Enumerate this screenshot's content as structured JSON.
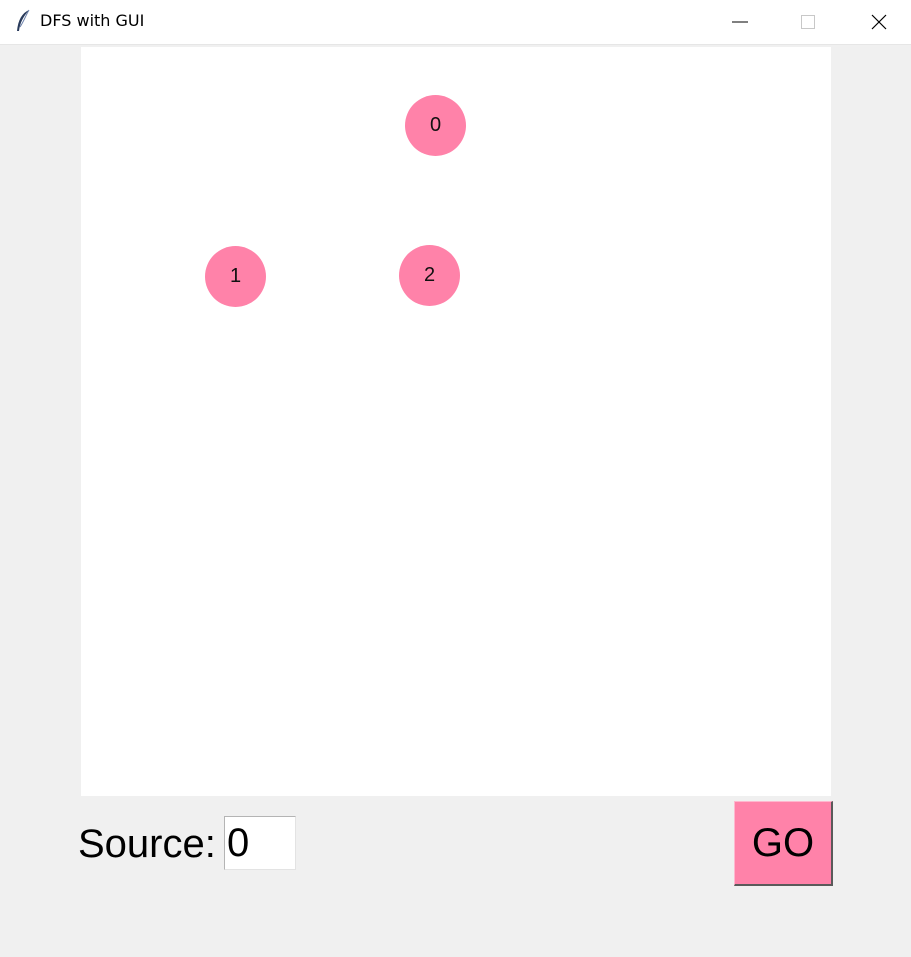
{
  "window": {
    "title": "DFS with GUI",
    "icon": "feather-icon"
  },
  "graph": {
    "nodes": [
      {
        "label": "0"
      },
      {
        "label": "1"
      },
      {
        "label": "2"
      }
    ],
    "node_color": "#ff82a9"
  },
  "controls": {
    "source_label": "Source:",
    "source_value": "0",
    "go_label": "GO",
    "go_color": "#ff82a9"
  }
}
